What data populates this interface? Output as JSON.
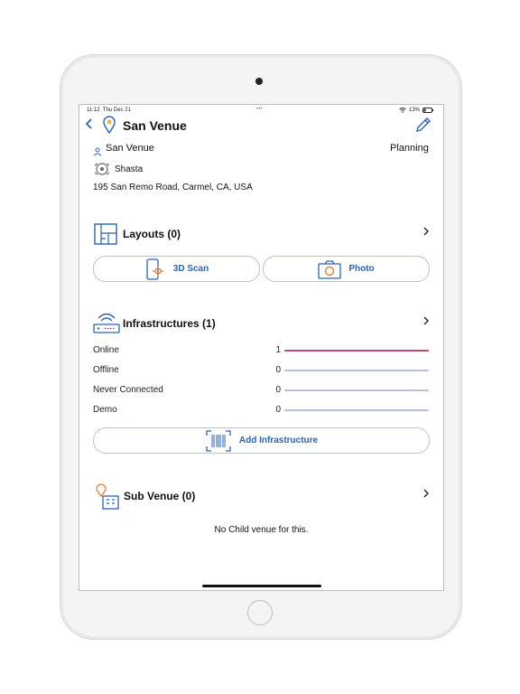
{
  "status": {
    "time": "11:12",
    "date": "Thu Dec 21",
    "dots": "•••",
    "battery": "13%"
  },
  "header": {
    "title": "San Venue"
  },
  "venue": {
    "name": "San Venue",
    "status": "Planning",
    "org": "Shasta",
    "address": "195 San Remo Road, Carmel, CA, USA"
  },
  "layouts": {
    "title": "Layouts (0)",
    "scan_label": "3D Scan",
    "photo_label": "Photo"
  },
  "infrastructures": {
    "title": "Infrastructures (1)",
    "rows": [
      {
        "label": "Online",
        "value": "1",
        "fraction": 1
      },
      {
        "label": "Offline",
        "value": "0",
        "fraction": 0
      },
      {
        "label": "Never Connected",
        "value": "0",
        "fraction": 0
      },
      {
        "label": "Demo",
        "value": "0",
        "fraction": 0
      }
    ],
    "add_label": "Add Infrastructure"
  },
  "subvenue": {
    "title": "Sub Venue (0)",
    "empty_text": "No Child venue for this."
  },
  "colors": {
    "accent": "#2c63b5",
    "online_bar": "#c04879",
    "track": "#b6c2dc"
  },
  "icons": {
    "back": "chevron-left-icon",
    "location": "location-pin-icon",
    "edit": "pencil-icon"
  }
}
